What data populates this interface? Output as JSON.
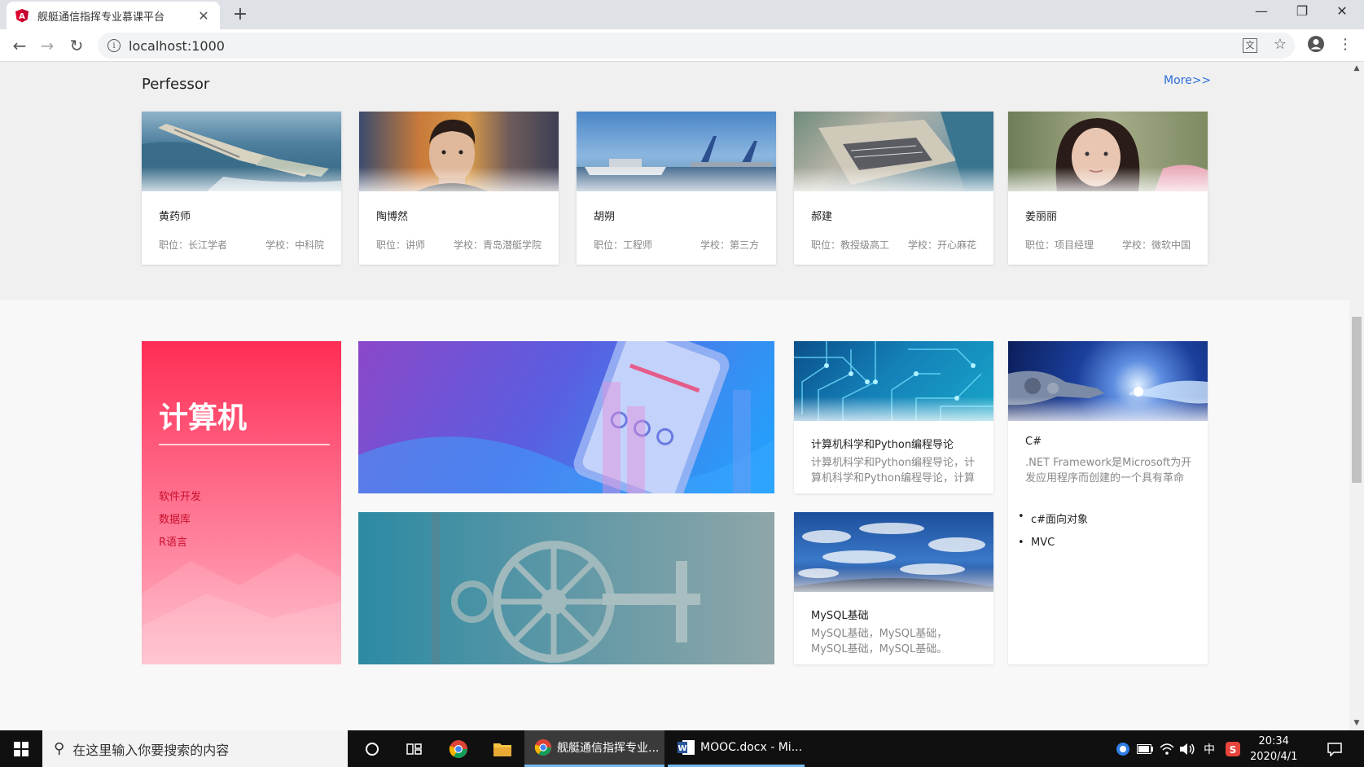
{
  "browser": {
    "tab_title": "舰艇通信指挥专业慕课平台",
    "tab_close": "✕",
    "new_tab": "+",
    "url": "localhost:1000",
    "win_min": "—",
    "win_max": "❐",
    "win_close": "✕"
  },
  "professors": {
    "title": "Perfessor",
    "more": "More>>",
    "items": [
      {
        "name": "黄药师",
        "position": "职位：长江学者",
        "school": "学校：中科院"
      },
      {
        "name": "陶博然",
        "position": "职位：讲师",
        "school": "学校：青岛潜艇学院"
      },
      {
        "name": "胡朔",
        "position": "职位：工程师",
        "school": "学校：第三方"
      },
      {
        "name": "郝建",
        "position": "职位：教授级高工",
        "school": "学校：开心麻花"
      },
      {
        "name": "姜丽丽",
        "position": "职位：项目经理",
        "school": "学校：微软中国"
      }
    ]
  },
  "category": {
    "title": "计算机",
    "items": [
      "软件开发",
      "数据库",
      "R语言"
    ]
  },
  "courses": [
    {
      "name": "计算机科学和Python编程导论",
      "desc": "计算机科学和Python编程导论，计算机科学和Python编程导论，计算机科学和Python编程导论。"
    },
    {
      "name": "MySQL基础",
      "desc": "MySQL基础，MySQL基础，MySQL基础，MySQL基础。"
    },
    {
      "name": "C#",
      "desc": ".NET Framework是Microsoft为开发应用程序而创建的一个具有革命意义的平台。.NET Framework"
    }
  ],
  "csharp_list": [
    "c#面向对象",
    "MVC"
  ],
  "taskbar": {
    "search_placeholder": "在这里输入你要搜索的内容",
    "app_chrome": "舰艇通信指挥专业...",
    "app_word": "MOOC.docx - Mi...",
    "ime": "中",
    "time": "20:34",
    "date": "2020/4/1"
  }
}
